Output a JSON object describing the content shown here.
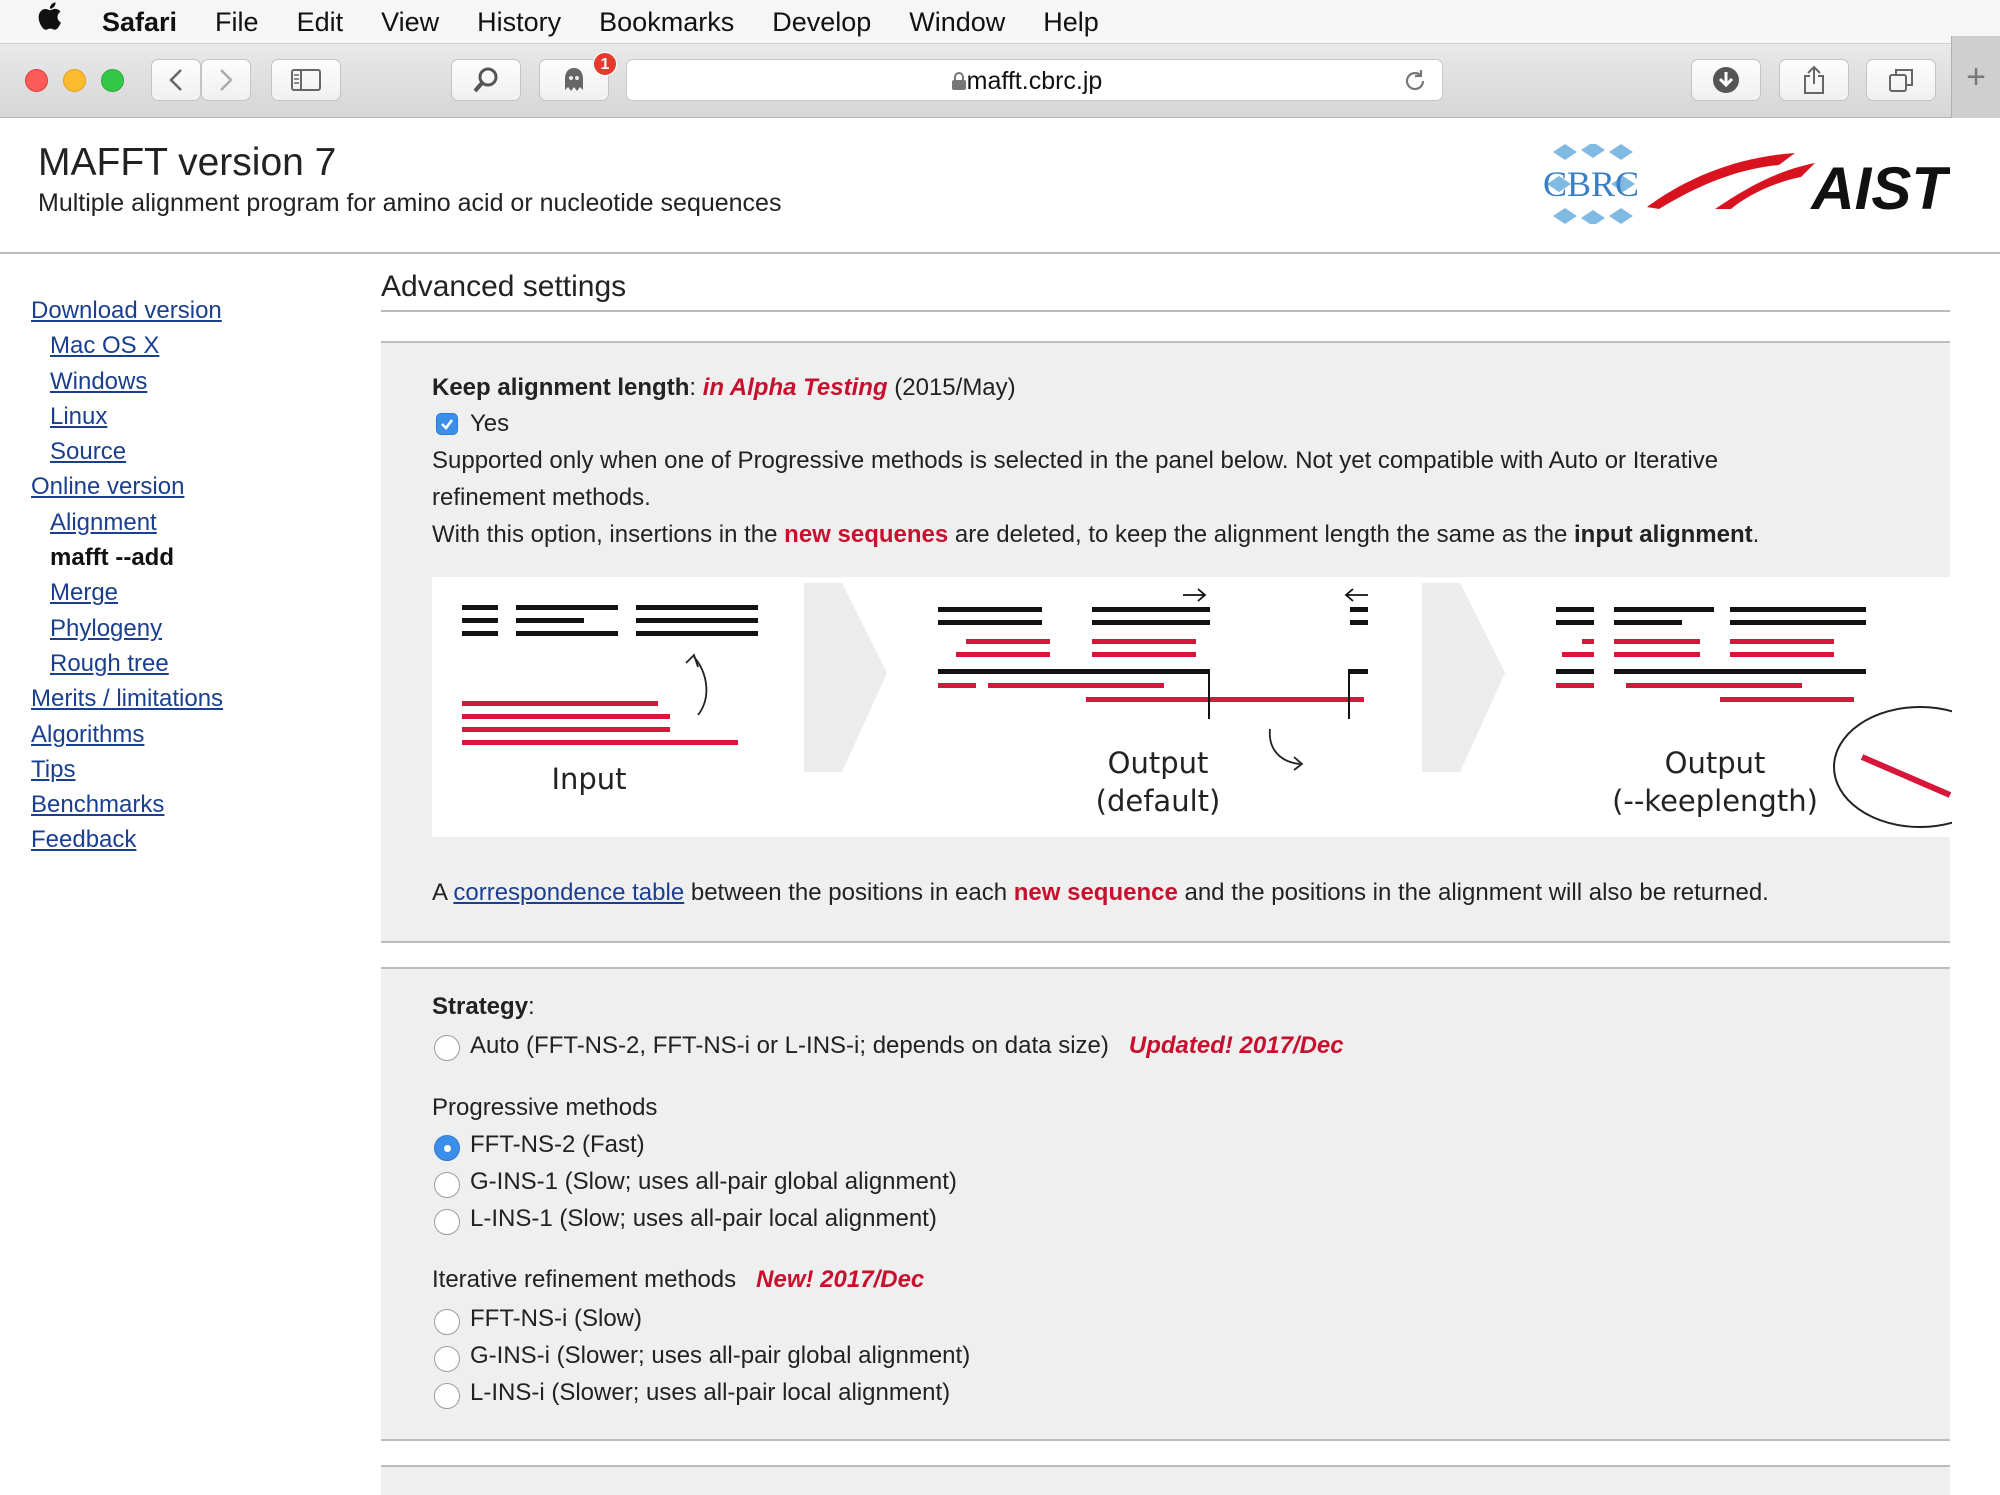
{
  "menubar": {
    "app_name": "Safari",
    "items": [
      "File",
      "Edit",
      "View",
      "History",
      "Bookmarks",
      "Develop",
      "Window",
      "Help"
    ]
  },
  "toolbar": {
    "url": "mafft.cbrc.jp",
    "notification_count": "1",
    "new_tab_label": "+"
  },
  "header": {
    "title": "MAFFT version 7",
    "subtitle": "Multiple alignment program for amino acid or nucleotide sequences",
    "logo_left": "CBRC",
    "logo_right": "AIST"
  },
  "sidebar": {
    "items": [
      {
        "label": "Download version"
      },
      {
        "label": "Mac OS X"
      },
      {
        "label": "Windows"
      },
      {
        "label": "Linux"
      },
      {
        "label": "Source"
      },
      {
        "label": "Online version"
      },
      {
        "label": "Alignment"
      },
      {
        "label": "mafft --add"
      },
      {
        "label": "Merge"
      },
      {
        "label": "Phylogeny"
      },
      {
        "label": "Rough tree"
      },
      {
        "label": "Merits / limitations"
      },
      {
        "label": "Algorithms"
      },
      {
        "label": "Tips"
      },
      {
        "label": "Benchmarks"
      },
      {
        "label": "Feedback"
      }
    ]
  },
  "main": {
    "heading": "Advanced settings",
    "keep_length": {
      "label": "Keep alignment length",
      "colon": ":",
      "alpha": "in Alpha Testing",
      "date": "(2015/May)",
      "checkbox_label": "Yes",
      "checked": true,
      "note_line1": "Supported only when one of Progressive methods is selected in the panel below.   Not yet compatible with Auto or Iterative",
      "note_line2": "refinement methods.",
      "note3_a": "With this option, insertions in the ",
      "note3_b": "new sequenes",
      "note3_c": " are deleted, to keep the alignment length the same as the ",
      "note3_d": "input alignment",
      "note3_e": ".",
      "diagram": {
        "input_label": "Input",
        "output_default_line1": "Output",
        "output_default_line2": "(default)",
        "output_keep_line1": "Output",
        "output_keep_line2": "(--keeplength)"
      },
      "corr_a": "A ",
      "corr_link": "correspondence table",
      "corr_b": " between the positions in each ",
      "corr_c": "new sequence",
      "corr_d": " and the positions in the alignment will also be returned."
    },
    "strategy": {
      "label": "Strategy",
      "colon": ":",
      "auto_label": "Auto (FFT-NS-2, FFT-NS-i or L-INS-i; depends on data size)",
      "auto_note": "Updated!  2017/Dec",
      "progressive_title": "Progressive methods",
      "progressive": [
        {
          "label": "FFT-NS-2 (Fast)",
          "selected": true
        },
        {
          "label": "G-INS-1 (Slow; uses all-pair global alignment)",
          "selected": false
        },
        {
          "label": "L-INS-1 (Slow; uses all-pair local alignment)",
          "selected": false
        }
      ],
      "iterative_title": "Iterative refinement methods",
      "iterative_note": "New!  2017/Dec",
      "iterative": [
        {
          "label": "FFT-NS-i (Slow)",
          "selected": false
        },
        {
          "label": "G-INS-i (Slower; uses all-pair global alignment)",
          "selected": false
        },
        {
          "label": "L-INS-i (Slower; uses all-pair local alignment)",
          "selected": false
        }
      ]
    }
  },
  "colors": {
    "link": "#1a3f8e",
    "accent_red": "#c8102e",
    "panel_bg": "#efefef",
    "radio_selected": "#3b8eea"
  }
}
